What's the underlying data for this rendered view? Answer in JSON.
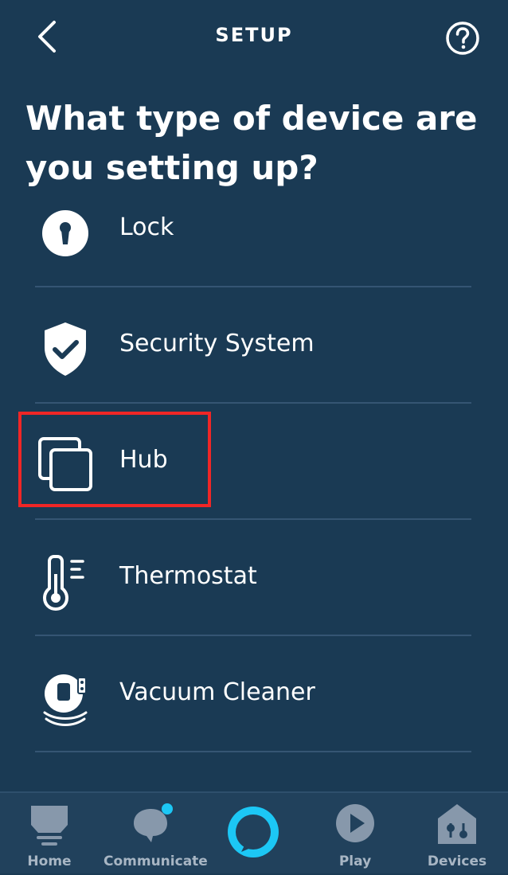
{
  "header": {
    "title": "SETUP",
    "back_icon": "chevron-left-icon",
    "help_icon": "question-circle-icon"
  },
  "question": "What type of device are you setting up?",
  "device_types": [
    {
      "label": "Lock",
      "icon": "lock-icon"
    },
    {
      "label": "Security System",
      "icon": "shield-check-icon"
    },
    {
      "label": "Hub",
      "icon": "hub-icon"
    },
    {
      "label": "Thermostat",
      "icon": "thermometer-icon"
    },
    {
      "label": "Vacuum Cleaner",
      "icon": "vacuum-icon"
    }
  ],
  "bottom_nav": {
    "items": [
      {
        "label": "Home",
        "icon": "home-icon"
      },
      {
        "label": "Communicate",
        "icon": "chat-bubble-icon"
      },
      {
        "label": "",
        "icon": "alexa-ring-icon"
      },
      {
        "label": "Play",
        "icon": "play-icon"
      },
      {
        "label": "Devices",
        "icon": "devices-house-icon"
      }
    ]
  },
  "colors": {
    "background": "#1a3a54",
    "divider": "#355573",
    "highlight": "#f02626",
    "alexa": "#1cc7f5",
    "nav_inactive": "#8798ab",
    "notification_dot": "#1cc7f5"
  }
}
